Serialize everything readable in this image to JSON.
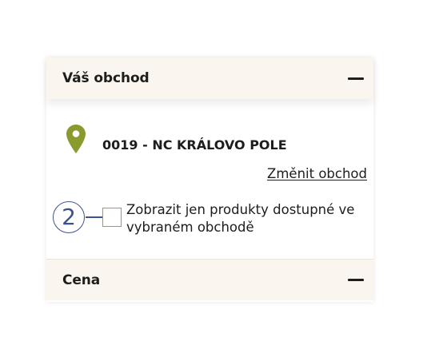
{
  "store_section": {
    "title": "Váš obchod",
    "collapse_icon": "minus-icon",
    "location_icon": "map-pin-icon",
    "location_icon_color": "#8a9a2f",
    "store_name": "0019 - NC KRÁLOVO POLE",
    "change_link": "Změnit obchod",
    "annotation_number": "2",
    "checkbox_checked": false,
    "checkbox_label": "Zobrazit jen produkty dostupné ve vybraném obchodě"
  },
  "price_section": {
    "title": "Cena",
    "collapse_icon": "minus-icon"
  },
  "colors": {
    "header_bg": "#faf5ee",
    "text": "#1d1d1b",
    "annotation": "#3d4f8d"
  }
}
